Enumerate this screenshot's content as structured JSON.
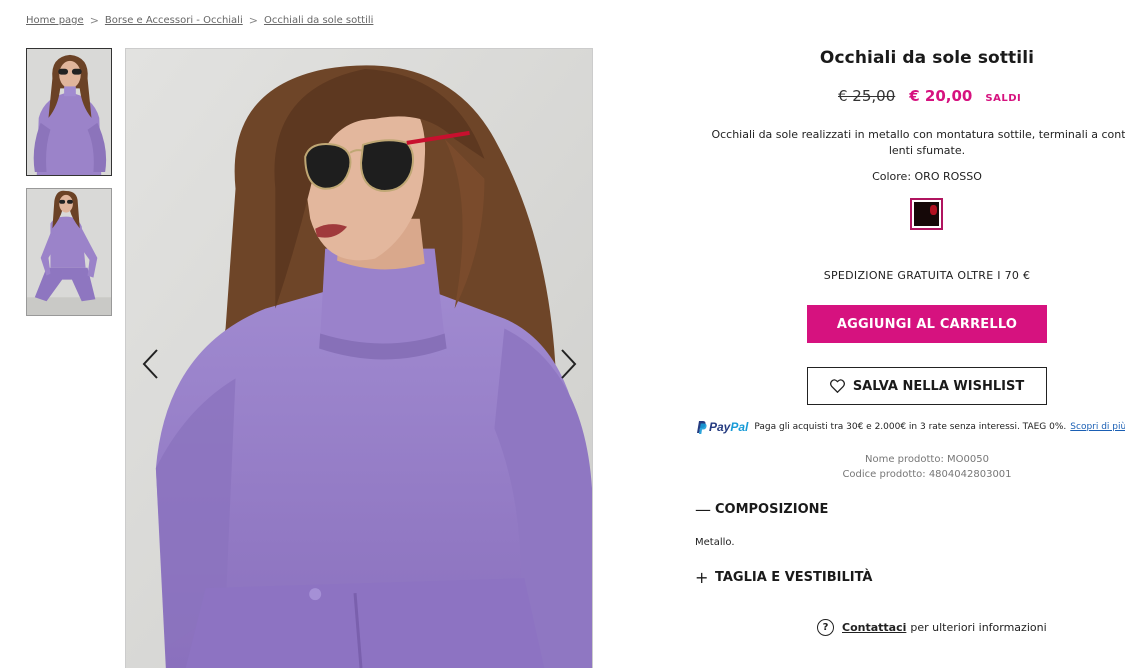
{
  "breadcrumb": {
    "items": [
      "Home page",
      "Borse e Accessori - Occhiali",
      "Occhiali da sole sottili"
    ],
    "separator": ">"
  },
  "gallery": {
    "thumbnails": [
      "product-photo-front",
      "product-photo-full-body"
    ],
    "main_image": "woman-wearing-sunglasses-lilac-outfit",
    "arrow_left": "chevron-left-icon",
    "arrow_right": "chevron-right-icon"
  },
  "product": {
    "title": "Occhiali da sole sottili",
    "price_old": "€ 25,00",
    "price_new": "€ 20,00",
    "sale_label": "SALDI",
    "description_line1": "Occhiali da sole realizzati in metallo con montatura sottile, terminali a contras",
    "description_line2": "lenti sfumate.",
    "color_label": "Colore: ORO ROSSO",
    "shipping": "SPEDIZIONE GRATUITA OLTRE I 70 €",
    "add_to_cart": "AGGIUNGI AL CARRELLO",
    "wishlist": "SALVA NELLA WISHLIST",
    "product_name_meta": "Nome prodotto: MO0050",
    "product_code_meta": "Codice prodotto: 4804042803001"
  },
  "paypal": {
    "logo_pay": "Pay",
    "logo_pal": "Pal",
    "text": "Paga gli acquisti tra 30€ e 2.000€ in 3 rate senza interessi. TAEG 0%.",
    "link": "Scopri di più"
  },
  "accordion": {
    "composition_sign": "—",
    "composition_title": "COMPOSIZIONE",
    "composition_text": "Metallo.",
    "size_sign": "+",
    "size_title": "TAGLIA E VESTIBILITÀ"
  },
  "contact": {
    "icon": "?",
    "link": "Contattaci",
    "text": "per ulteriori informazioni"
  },
  "colors": {
    "accent": "#d6127f",
    "paypal_dark": "#253b80",
    "paypal_light": "#179bd7",
    "outfit": "#9b83c9"
  }
}
